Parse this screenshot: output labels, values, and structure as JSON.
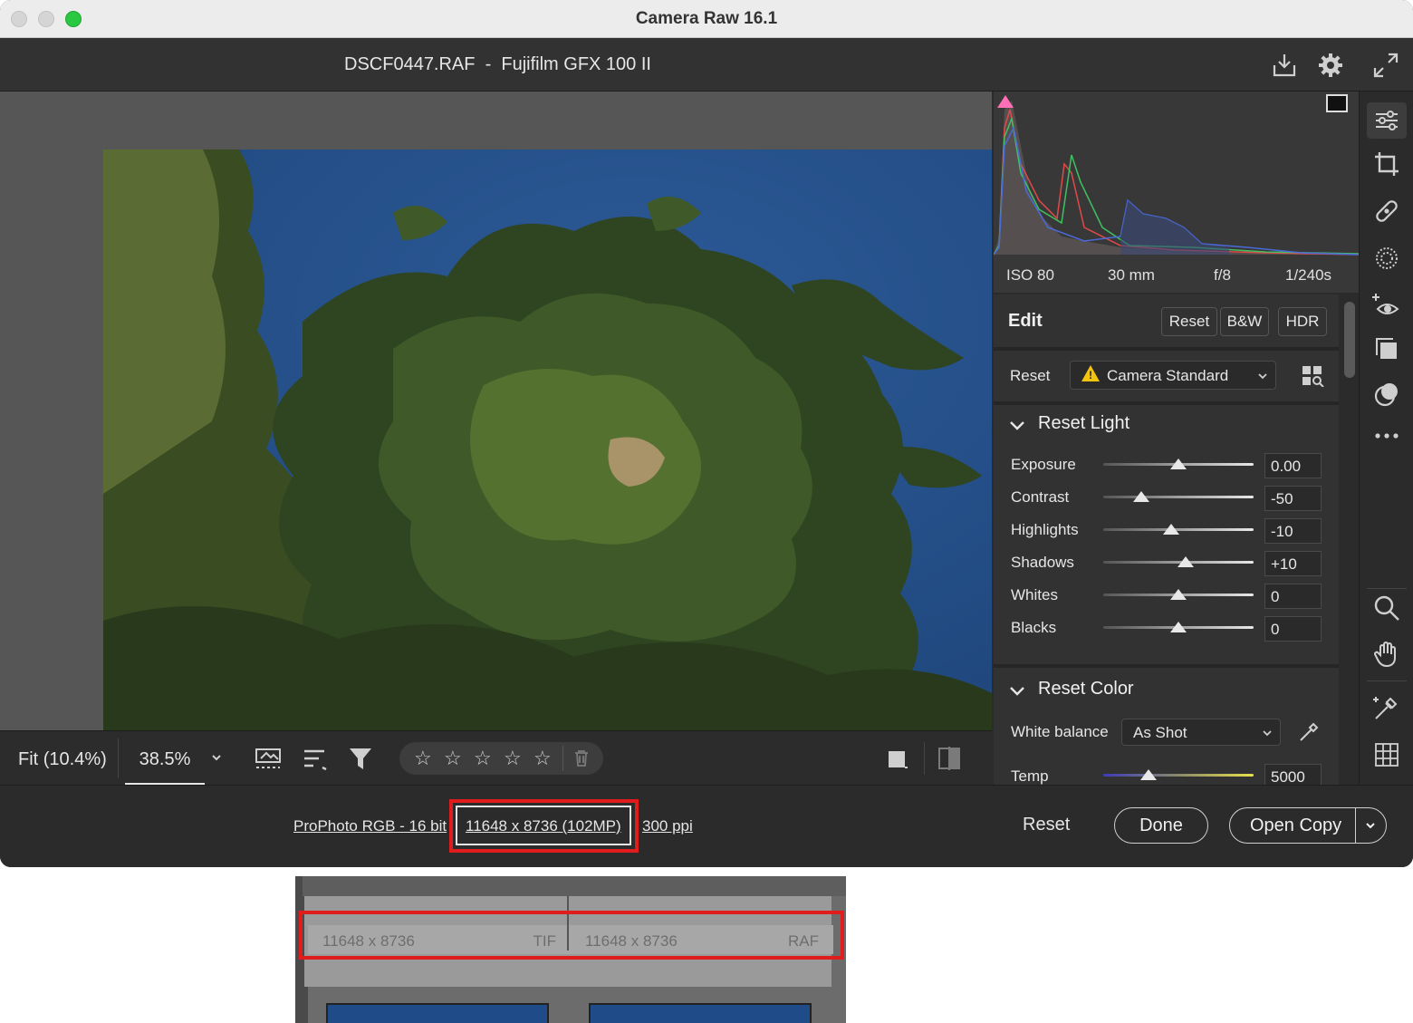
{
  "window": {
    "title": "Camera Raw 16.1"
  },
  "appbar": {
    "file_title": "DSCF0447.RAF  -  Fujifilm GFX 100 II",
    "icons": [
      "save-download-icon",
      "gear-icon",
      "expand-icon"
    ]
  },
  "toolbar": {
    "fit_label": "Fit (10.4%)",
    "zoom_value": "38.5%",
    "rating_stars": 5
  },
  "histogram": {
    "iso": "ISO 80",
    "focal": "30 mm",
    "aperture": "f/8",
    "shutter": "1/240s"
  },
  "edit_panel": {
    "title": "Edit",
    "reset_btn": "Reset",
    "bw_btn": "B&W",
    "hdr_btn": "HDR",
    "profile_label": "Reset",
    "profile_value": "Camera Standard",
    "light": {
      "title": "Reset Light",
      "sliders": [
        {
          "label": "Exposure",
          "value": "0.00",
          "level": 0.5
        },
        {
          "label": "Contrast",
          "value": "-50",
          "level": 0.25
        },
        {
          "label": "Highlights",
          "value": "-10",
          "level": 0.45
        },
        {
          "label": "Shadows",
          "value": "+10",
          "level": 0.55
        },
        {
          "label": "Whites",
          "value": "0",
          "level": 0.5
        },
        {
          "label": "Blacks",
          "value": "0",
          "level": 0.5
        }
      ]
    },
    "color": {
      "title": "Reset Color",
      "wb_label": "White balance",
      "wb_value": "As Shot",
      "temp_label": "Temp",
      "temp_value": "5000",
      "temp_level": 0.3
    }
  },
  "footer": {
    "color_space": "ProPhoto RGB - 16 bit",
    "dimensions": "11648 x 8736 (102MP)",
    "resolution": "300 ppi",
    "reset": "Reset",
    "done": "Done",
    "open_copy": "Open Copy"
  },
  "inset": {
    "items": [
      {
        "dims": "11648 x 8736",
        "ext": "TIF"
      },
      {
        "dims": "11648 x 8736",
        "ext": "RAF"
      }
    ]
  },
  "colors": {
    "highlight_red": "#e01c1c",
    "sky_blue": "#244e86",
    "clip_warning": "#ff6fb5"
  }
}
